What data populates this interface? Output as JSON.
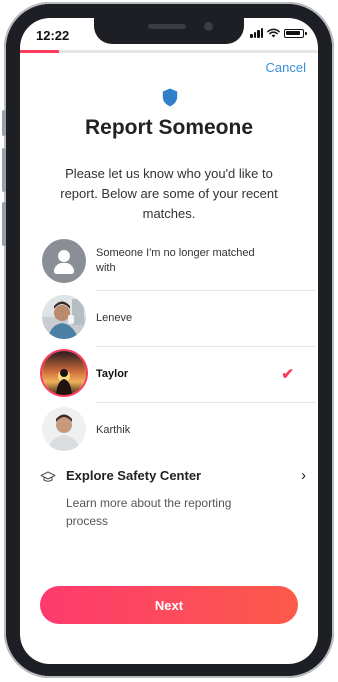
{
  "status_bar": {
    "time": "12:22"
  },
  "progress": {
    "value": 0.13
  },
  "header": {
    "cancel_label": "Cancel",
    "icon": "shield-icon"
  },
  "page": {
    "title": "Report Someone",
    "intro": "Please let us know who you'd like to report. Below are some of your recent matches."
  },
  "matches": [
    {
      "name": "Someone I'm no longer matched with",
      "avatar": "person-placeholder-icon",
      "selected": false
    },
    {
      "name": "Leneve",
      "avatar": "photo",
      "selected": false
    },
    {
      "name": "Taylor",
      "avatar": "photo",
      "selected": true
    },
    {
      "name": "Karthik",
      "avatar": "photo",
      "selected": false
    }
  ],
  "safety": {
    "title": "Explore Safety Center",
    "description": "Learn more about the reporting process",
    "icon": "graduation-cap-icon"
  },
  "actions": {
    "next_label": "Next"
  },
  "colors": {
    "accent": "#fd3a5b",
    "link": "#3a8fd8",
    "shield": "#2f80c9"
  }
}
